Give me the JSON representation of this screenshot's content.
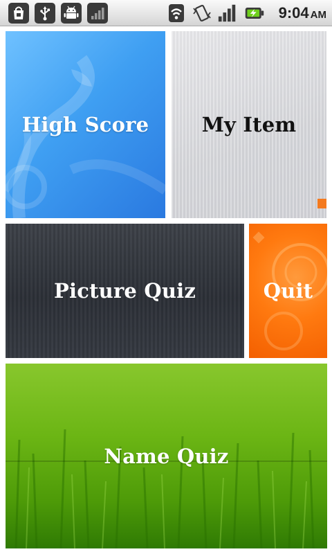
{
  "status_bar": {
    "left_icons": [
      "shopping-bag-icon",
      "usb-icon",
      "android-icon",
      "signal-bars-icon"
    ],
    "right_icons": [
      "wifi-icon",
      "vibrate-icon",
      "cell-signal-icon",
      "battery-charging-icon"
    ],
    "time": "9:04",
    "ampm": "AM"
  },
  "tiles": {
    "high_score": {
      "label": "High Score",
      "color": "#3f9ff2"
    },
    "my_item": {
      "label": "My Item",
      "color": "#d8d9dd"
    },
    "picture_quiz": {
      "label": "Picture Quiz",
      "color": "#30343b"
    },
    "quit": {
      "label": "Quit",
      "color": "#ff7a10"
    },
    "name_quiz": {
      "label": "Name Quiz",
      "color": "#6bb514"
    }
  }
}
